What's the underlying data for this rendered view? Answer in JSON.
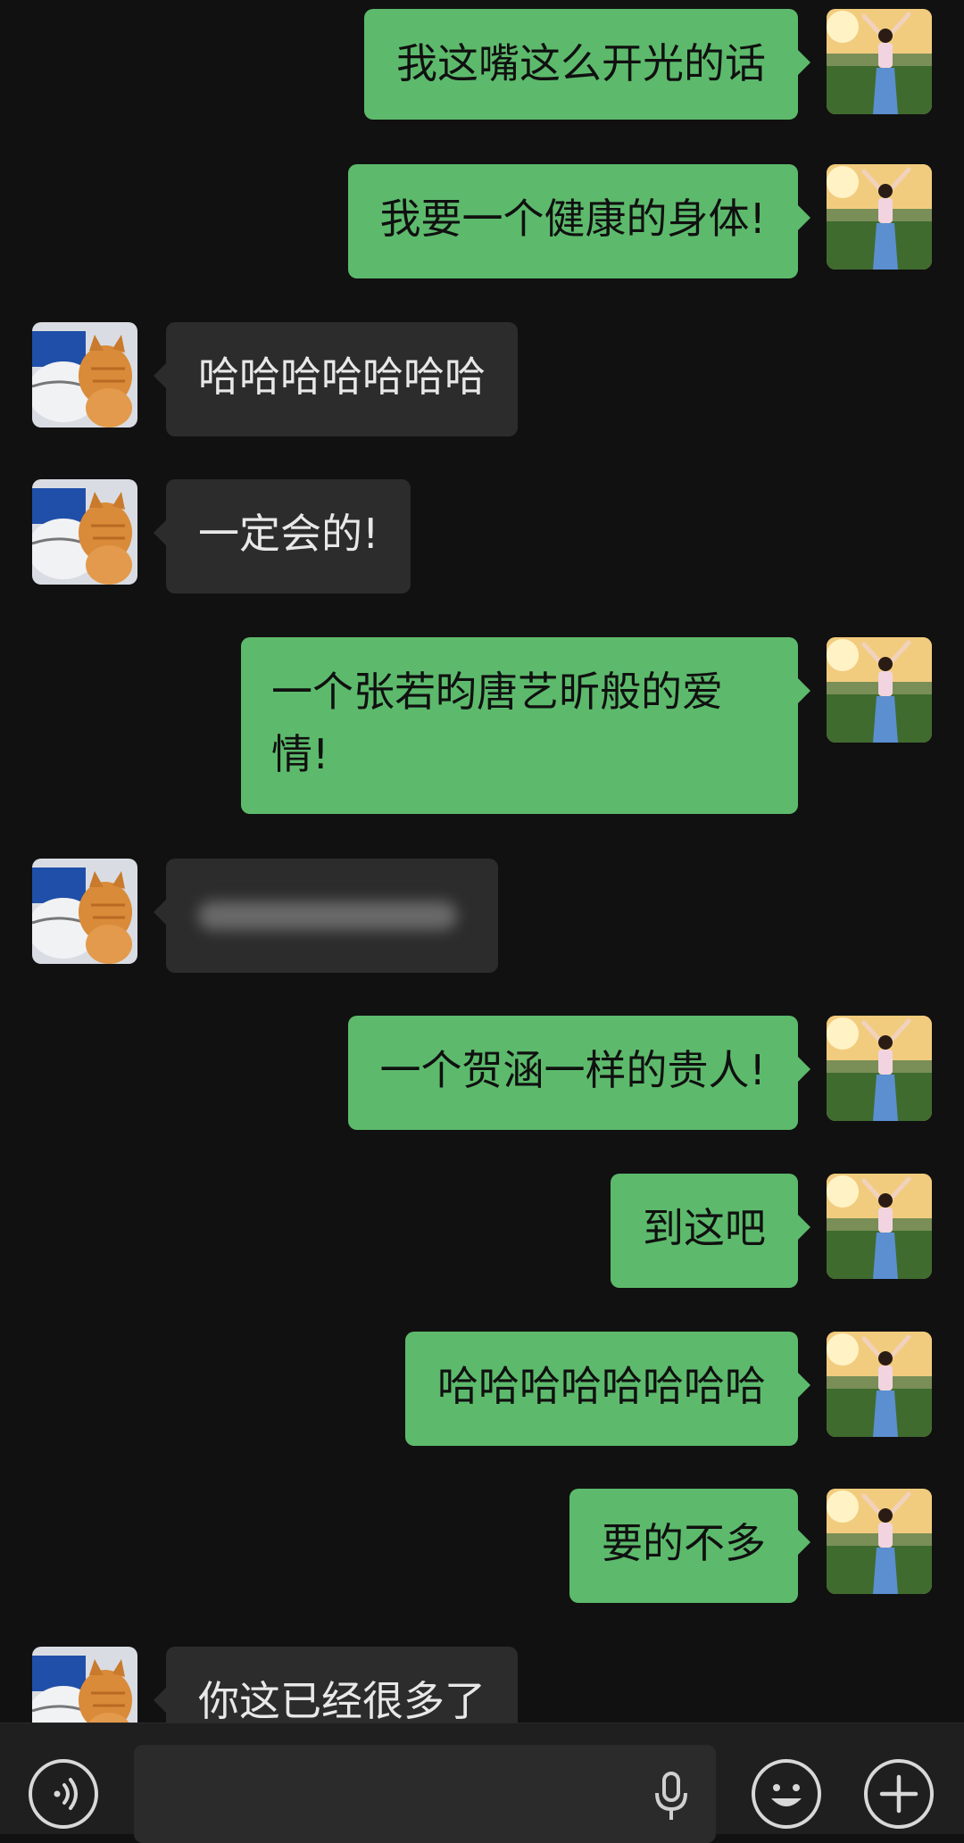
{
  "messages": [
    {
      "side": "me",
      "text": "我这嘴这么开光的话"
    },
    {
      "side": "me",
      "text": "我要一个健康的身体!"
    },
    {
      "side": "them",
      "text": "哈哈哈哈哈哈哈"
    },
    {
      "side": "them",
      "text": "一定会的!"
    },
    {
      "side": "me",
      "text": "一个张若昀唐艺昕般的爱情!"
    },
    {
      "side": "them",
      "text": "",
      "blurred": true
    },
    {
      "side": "me",
      "text": "一个贺涵一样的贵人!"
    },
    {
      "side": "me",
      "text": "到这吧"
    },
    {
      "side": "me",
      "text": "哈哈哈哈哈哈哈哈"
    },
    {
      "side": "me",
      "text": "要的不多"
    },
    {
      "side": "them",
      "text": "你这已经很多了"
    }
  ],
  "input_bar": {
    "voice_icon": "voice-mode-icon",
    "mic_icon": "microphone-icon",
    "emoji_icon": "emoji-icon",
    "plus_icon": "plus-icon"
  },
  "colors": {
    "background": "#111111",
    "my_bubble": "#5dba6c",
    "their_bubble": "#2c2c2c"
  }
}
